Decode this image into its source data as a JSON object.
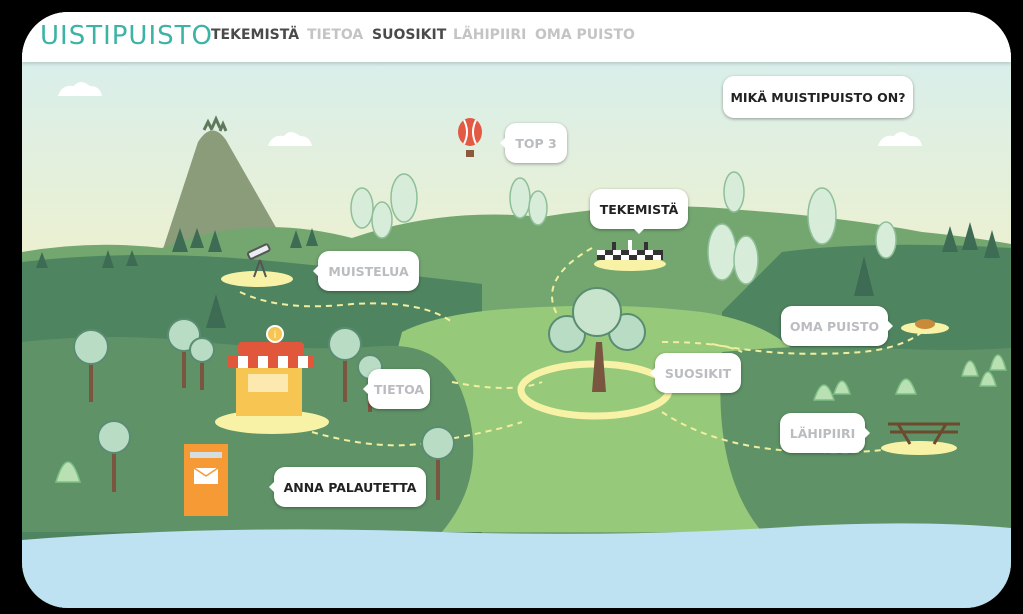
{
  "logo": {
    "text": "UISTIPUISTO"
  },
  "nav": {
    "items": [
      {
        "label": "TEKEMISTÄ",
        "active": true
      },
      {
        "label": "TIETOA",
        "active": false
      },
      {
        "label": "SUOSIKIT",
        "active": true
      },
      {
        "label": "LÄHIPIIRI",
        "active": false
      },
      {
        "label": "OMA PUISTO",
        "active": false
      }
    ]
  },
  "map": {
    "about_button": "MIKÄ MUISTIPUISTO ON?",
    "top3": "TOP 3",
    "tekemista": "TEKEMISTÄ",
    "muistelua": "MUISTELUA",
    "oma_puisto": "OMA PUISTO",
    "suosikit": "SUOSIKIT",
    "tietoa": "TIETOA",
    "lahipiiri": "LÄHIPIIRI",
    "feedback": "ANNA PALAUTETTA",
    "kiosk_sign": "i"
  },
  "colors": {
    "logo_teal": "#3cb3a5",
    "sky_top": "#d6eef0",
    "sky_bottom": "#f8f0b0",
    "grass_dark": "#4f8460",
    "grass_mid": "#73a76f",
    "grass_light": "#97c97a",
    "water": "#bfe2f3",
    "path": "#f7f2a6",
    "mailbox": "#f59a35"
  }
}
